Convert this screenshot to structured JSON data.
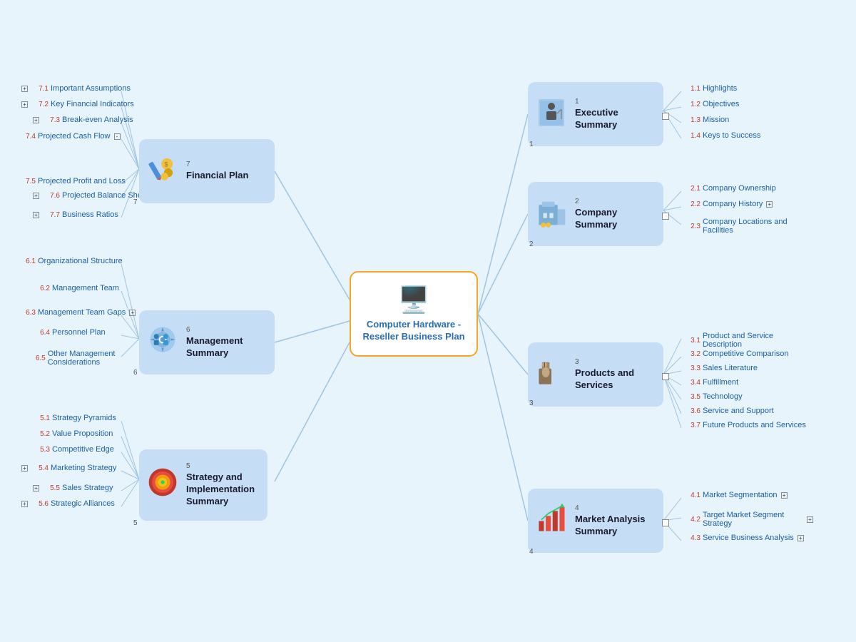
{
  "title": "Computer Hardware - Reseller Business Plan",
  "central": {
    "label": "Computer Hardware -\nReseller Business Plan",
    "icon": "💻"
  },
  "topics": [
    {
      "id": "executive",
      "num": "1",
      "label": "Executive Summary",
      "icon": "📊",
      "iconType": "chart"
    },
    {
      "id": "company",
      "num": "2",
      "label": "Company Summary",
      "icon": "🏢",
      "iconType": "building"
    },
    {
      "id": "products",
      "num": "3",
      "label": "Products and Services",
      "icon": "📦",
      "iconType": "box"
    },
    {
      "id": "market",
      "num": "4",
      "label": "Market Analysis Summary",
      "icon": "📈",
      "iconType": "trend"
    },
    {
      "id": "strategy",
      "num": "5",
      "label": "Strategy and Implementation Summary",
      "icon": "🎯",
      "iconType": "target"
    },
    {
      "id": "management",
      "num": "6",
      "label": "Management Summary",
      "icon": "⚙️",
      "iconType": "gear"
    },
    {
      "id": "financial",
      "num": "7",
      "label": "Financial Plan",
      "icon": "💰",
      "iconType": "money"
    }
  ],
  "subitems": {
    "executive": [
      {
        "num": "1.1",
        "label": "Highlights",
        "expand": false
      },
      {
        "num": "1.2",
        "label": "Objectives",
        "expand": false
      },
      {
        "num": "1.3",
        "label": "Mission",
        "expand": false
      },
      {
        "num": "1.4",
        "label": "Keys to Success",
        "expand": false
      }
    ],
    "company": [
      {
        "num": "2.1",
        "label": "Company Ownership",
        "expand": false
      },
      {
        "num": "2.2",
        "label": "Company History",
        "expand": true
      },
      {
        "num": "2.3",
        "label": "Company Locations and Facilities",
        "expand": false
      }
    ],
    "products": [
      {
        "num": "3.1",
        "label": "Product and Service Description",
        "expand": false
      },
      {
        "num": "3.2",
        "label": "Competitive Comparison",
        "expand": false
      },
      {
        "num": "3.3",
        "label": "Sales Literature",
        "expand": false
      },
      {
        "num": "3.4",
        "label": "Fulfillment",
        "expand": false
      },
      {
        "num": "3.5",
        "label": "Technology",
        "expand": false
      },
      {
        "num": "3.6",
        "label": "Service and Support",
        "expand": false
      },
      {
        "num": "3.7",
        "label": "Future Products and Services",
        "expand": false
      }
    ],
    "market": [
      {
        "num": "4.1",
        "label": "Market Segmentation",
        "expand": true
      },
      {
        "num": "4.2",
        "label": "Target Market Segment Strategy",
        "expand": true
      },
      {
        "num": "4.3",
        "label": "Service Business Analysis",
        "expand": true
      }
    ],
    "strategy": [
      {
        "num": "5.1",
        "label": "Strategy Pyramids",
        "expand": false
      },
      {
        "num": "5.2",
        "label": "Value Proposition",
        "expand": false
      },
      {
        "num": "5.3",
        "label": "Competitive Edge",
        "expand": false
      },
      {
        "num": "5.4",
        "label": "Marketing Strategy",
        "expand": true
      },
      {
        "num": "5.5",
        "label": "Sales Strategy",
        "expand": true
      },
      {
        "num": "5.6",
        "label": "Strategic Alliances",
        "expand": true
      }
    ],
    "management": [
      {
        "num": "6.1",
        "label": "Organizational Structure",
        "expand": false
      },
      {
        "num": "6.2",
        "label": "Management Team",
        "expand": false
      },
      {
        "num": "6.3",
        "label": "Management Team Gaps",
        "expand": true
      },
      {
        "num": "6.4",
        "label": "Personnel Plan",
        "expand": false
      },
      {
        "num": "6.5",
        "label": "Other Management Considerations",
        "expand": false
      }
    ],
    "financial": [
      {
        "num": "7.1",
        "label": "Important Assumptions",
        "expand": false
      },
      {
        "num": "7.2",
        "label": "Key Financial Indicators",
        "expand": false
      },
      {
        "num": "7.3",
        "label": "Break-even Analysis",
        "expand": true
      },
      {
        "num": "7.4",
        "label": "Projected Cash Flow",
        "expand": true
      },
      {
        "num": "7.5",
        "label": "Projected Profit and Loss",
        "expand": false
      },
      {
        "num": "7.6",
        "label": "Projected Balance Sheet",
        "expand": true
      },
      {
        "num": "7.7",
        "label": "Business Ratios",
        "expand": true
      }
    ]
  },
  "colors": {
    "background": "#e8f4fb",
    "topicBg": "#c5def5",
    "centralBorder": "#f5a623",
    "centralLabel": "#2a6db5",
    "subItemColor": "#1a5fa8",
    "numColor": "#c0392b",
    "connectorLine": "#a0c4e0"
  }
}
